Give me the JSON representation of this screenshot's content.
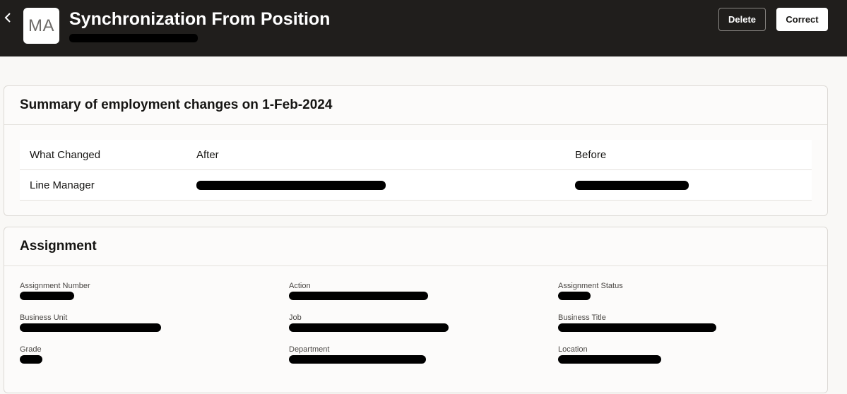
{
  "header": {
    "back_icon": "chevron-left-icon",
    "avatar_initials": "MA",
    "title": "Synchronization From Position",
    "delete_label": "Delete",
    "correct_label": "Correct"
  },
  "summary": {
    "title": "Summary of employment changes on 1-Feb-2024",
    "columns": [
      "What Changed",
      "After",
      "Before"
    ],
    "rows": [
      {
        "what_changed": "Line Manager"
      }
    ]
  },
  "assignment": {
    "title": "Assignment",
    "fields": [
      {
        "label": "Assignment Number"
      },
      {
        "label": "Action"
      },
      {
        "label": "Assignment Status"
      },
      {
        "label": "Business Unit"
      },
      {
        "label": "Job"
      },
      {
        "label": "Business Title"
      },
      {
        "label": "Grade"
      },
      {
        "label": "Department"
      },
      {
        "label": "Location"
      }
    ]
  },
  "colors": {
    "header_bg": "#201e1c",
    "page_bg": "#f9f8f6",
    "redaction": "#000000"
  }
}
